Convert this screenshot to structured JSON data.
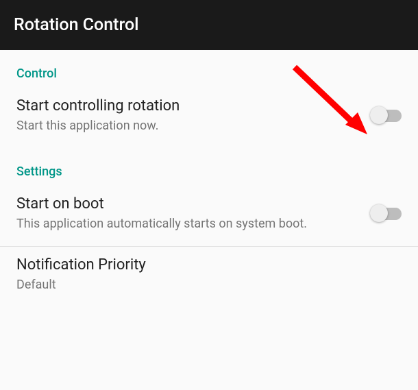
{
  "header": {
    "title": "Rotation Control"
  },
  "sections": {
    "control": {
      "label": "Control",
      "items": {
        "start_controlling": {
          "title": "Start controlling rotation",
          "subtitle": "Start this application now.",
          "toggle_state": false
        }
      }
    },
    "settings": {
      "label": "Settings",
      "items": {
        "start_on_boot": {
          "title": "Start on boot",
          "subtitle": "This application automatically starts on system boot.",
          "toggle_state": false
        },
        "notification_priority": {
          "title": "Notification Priority",
          "subtitle": "Default"
        }
      }
    }
  },
  "colors": {
    "accent": "#009688",
    "header_bg": "#1a1a1a"
  }
}
